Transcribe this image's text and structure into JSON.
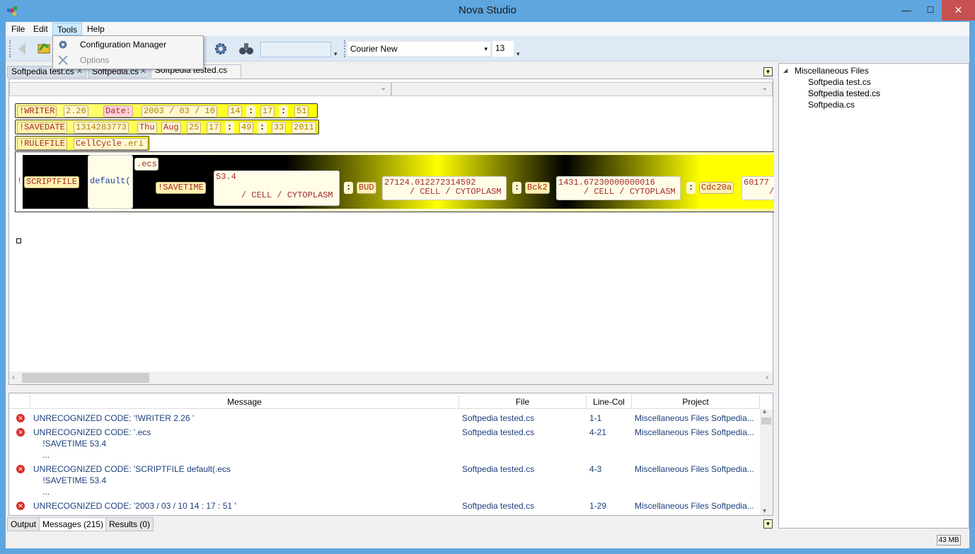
{
  "window": {
    "title": "Nova Studio",
    "minimize": "—",
    "maximize": "☐",
    "close": "✕"
  },
  "menu": {
    "file": "File",
    "edit": "Edit",
    "tools": "Tools",
    "help": "Help"
  },
  "tools_menu": {
    "config": "Configuration Manager",
    "options": "Options"
  },
  "toolbar": {
    "font": "Courier New",
    "size": "13",
    "dd": "▾",
    "overflow": "▾"
  },
  "tabs": [
    {
      "label": "Softpedia test.cs",
      "close": "✕"
    },
    {
      "label": "Softpedia.cs",
      "close": "✕"
    },
    {
      "label": "Softpedia tested.cs"
    }
  ],
  "pane_btn": "▼",
  "combo_chev": "⌄",
  "code": {
    "r1": {
      "a": "!WRITER",
      "b": "2.26",
      "c": "Date:",
      "d": "2003 / 03 / 10",
      "e": "14",
      "f": ":",
      "g": "17",
      "h": ":",
      "i": "51"
    },
    "r2": {
      "a": "!SAVEDATE",
      "b": "1314283773",
      "c": "Thu",
      "d": "Aug",
      "e": "25",
      "f": "17",
      "g": ":",
      "h": "49",
      "i": ":",
      "j": "33",
      "k": "2011"
    },
    "r3": {
      "a": "!RULEFILE",
      "b": "CellCycle",
      "c": ".eri"
    },
    "r4": {
      "bang": "!",
      "script": "SCRIPTFILE",
      "def": "default(",
      "paren": "(",
      "ecs": ".ecs",
      "savetime": "!SAVETIME",
      "v1": "53.4\n\n     / CELL / CYTOPLASM",
      "colon": ":",
      "bud": "BUD",
      "v2": "27124.012272314592\n     / CELL / CYTOPLASM",
      "bck2": "Bck2",
      "v3": "1431.67230000000016\n     / CELL / CYTOPLASM",
      "cdc": "Cdc20a",
      "v4": "60177\n     /"
    }
  },
  "explorer": {
    "root": "Miscellaneous Files",
    "arrow": "◢",
    "files": [
      "Softpedia test.cs",
      "Softpedia tested.cs",
      "Softpedia.cs"
    ]
  },
  "messages": {
    "headers": {
      "message": "Message",
      "file": "File",
      "linecol": "Line-Col",
      "project": "Project"
    },
    "rows": [
      {
        "message": "UNRECOGNIZED CODE: '!WRITER 2.26 '",
        "file": "Softpedia tested.cs",
        "linecol": "1-1",
        "project": "Miscellaneous Files Softpedia..."
      },
      {
        "message": "UNRECOGNIZED CODE: '.ecs\n    !SAVETIME 53.4\n    ...",
        "file": "Softpedia tested.cs",
        "linecol": "4-21",
        "project": "Miscellaneous Files Softpedia..."
      },
      {
        "message": "UNRECOGNIZED CODE: 'SCRIPTFILE default(.ecs\n    !SAVETIME 53.4\n    ...",
        "file": "Softpedia tested.cs",
        "linecol": "4-3",
        "project": "Miscellaneous Files Softpedia..."
      },
      {
        "message": "UNRECOGNIZED CODE: '2003 / 03 / 10 14 : 17 : 51 '",
        "file": "Softpedia tested.cs",
        "linecol": "1-29",
        "project": "Miscellaneous Files Softpedia..."
      }
    ],
    "err": "✕",
    "up": "▴",
    "down": "▾"
  },
  "bottom_tabs": {
    "output": "Output",
    "messages": "Messages (215)",
    "results": "Results (0)"
  },
  "scroll": {
    "left": "‹",
    "right": "›"
  },
  "status": {
    "mem": "43 MB"
  }
}
